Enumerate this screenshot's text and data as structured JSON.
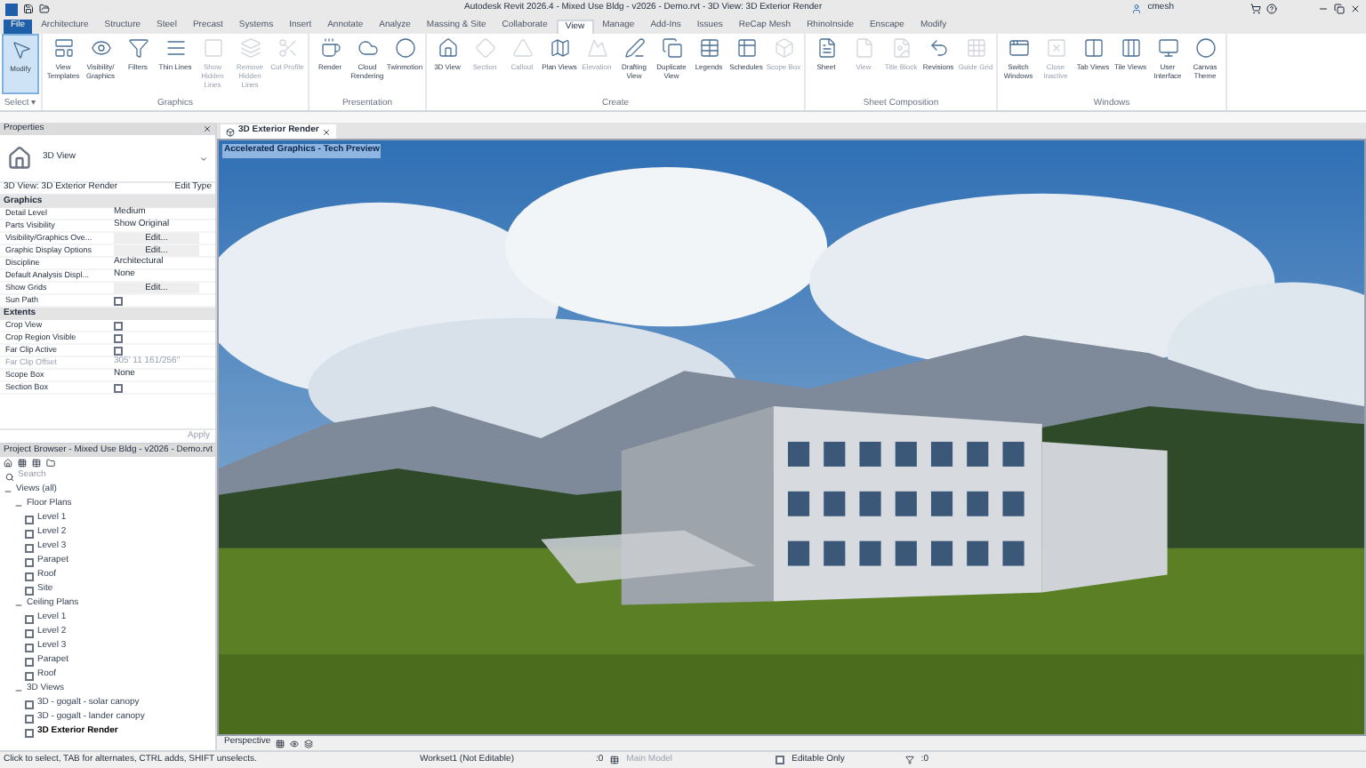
{
  "title_bar": {
    "title": "Autodesk Revit 2026.4 - Mixed Use Bldg - v2026 - Demo.rvt - 3D View: 3D Exterior Render",
    "user": "cmesh"
  },
  "ribbon_tabs": [
    {
      "label": "File",
      "selected": false,
      "kind": "file"
    },
    {
      "label": "Architecture",
      "selected": false,
      "kind": "tab"
    },
    {
      "label": "Structure",
      "selected": false,
      "kind": "tab"
    },
    {
      "label": "Steel",
      "selected": false,
      "kind": "tab"
    },
    {
      "label": "Precast",
      "selected": false,
      "kind": "tab"
    },
    {
      "label": "Systems",
      "selected": false,
      "kind": "tab"
    },
    {
      "label": "Insert",
      "selected": false,
      "kind": "tab"
    },
    {
      "label": "Annotate",
      "selected": false,
      "kind": "tab"
    },
    {
      "label": "Analyze",
      "selected": false,
      "kind": "tab"
    },
    {
      "label": "Massing & Site",
      "selected": false,
      "kind": "tab"
    },
    {
      "label": "Collaborate",
      "selected": false,
      "kind": "tab"
    },
    {
      "label": "View",
      "selected": true,
      "kind": "tab"
    },
    {
      "label": "Manage",
      "selected": false,
      "kind": "tab"
    },
    {
      "label": "Add-Ins",
      "selected": false,
      "kind": "tab"
    },
    {
      "label": "Issues",
      "selected": false,
      "kind": "tab"
    },
    {
      "label": "ReCap Mesh",
      "selected": false,
      "kind": "tab"
    },
    {
      "label": "RhinoInside",
      "selected": false,
      "kind": "tab"
    },
    {
      "label": "Enscape",
      "selected": false,
      "kind": "tab"
    },
    {
      "label": "Modify",
      "selected": false,
      "kind": "tab"
    }
  ],
  "ribbon_panels": [
    {
      "title": "Select ▾",
      "tools": [
        {
          "label": "Modify",
          "disabled": false,
          "selected": true
        }
      ]
    },
    {
      "title": "Graphics",
      "tools": [
        {
          "label": "View Templates",
          "disabled": false,
          "selected": false
        },
        {
          "label": "Visibility/ Graphics",
          "disabled": false,
          "selected": false
        },
        {
          "label": "Filters",
          "disabled": false,
          "selected": false
        },
        {
          "label": "Thin Lines",
          "disabled": false,
          "selected": false
        },
        {
          "label": "Show Hidden Lines",
          "disabled": true,
          "selected": false
        },
        {
          "label": "Remove Hidden Lines",
          "disabled": true,
          "selected": false
        },
        {
          "label": "Cut Profile",
          "disabled": true,
          "selected": false
        }
      ]
    },
    {
      "title": "Presentation",
      "tools": [
        {
          "label": "Render",
          "disabled": false,
          "selected": false
        },
        {
          "label": "Cloud Rendering",
          "disabled": false,
          "selected": false
        },
        {
          "label": "Twinmotion",
          "disabled": false,
          "selected": false
        }
      ]
    },
    {
      "title": "Create",
      "tools": [
        {
          "label": "3D View",
          "disabled": false,
          "selected": false
        },
        {
          "label": "Section",
          "disabled": true,
          "selected": false
        },
        {
          "label": "Callout",
          "disabled": true,
          "selected": false
        },
        {
          "label": "Plan Views",
          "disabled": false,
          "selected": false
        },
        {
          "label": "Elevation",
          "disabled": true,
          "selected": false
        },
        {
          "label": "Drafting View",
          "disabled": false,
          "selected": false
        },
        {
          "label": "Duplicate View",
          "disabled": false,
          "selected": false
        },
        {
          "label": "Legends",
          "disabled": false,
          "selected": false
        },
        {
          "label": "Schedules",
          "disabled": false,
          "selected": false
        },
        {
          "label": "Scope Box",
          "disabled": true,
          "selected": false
        }
      ]
    },
    {
      "title": "Sheet Composition",
      "tools": [
        {
          "label": "Sheet",
          "disabled": false,
          "selected": false
        },
        {
          "label": "View",
          "disabled": true,
          "selected": false
        },
        {
          "label": "Title Block",
          "disabled": true,
          "selected": false
        },
        {
          "label": "Revisions",
          "disabled": false,
          "selected": false
        },
        {
          "label": "Guide Grid",
          "disabled": true,
          "selected": false
        }
      ]
    },
    {
      "title": "Windows",
      "tools": [
        {
          "label": "Switch Windows",
          "disabled": false,
          "selected": false
        },
        {
          "label": "Close Inactive",
          "disabled": true,
          "selected": false
        },
        {
          "label": "Tab Views",
          "disabled": false,
          "selected": false
        },
        {
          "label": "Tile Views",
          "disabled": false,
          "selected": false
        },
        {
          "label": "User Interface",
          "disabled": false,
          "selected": false
        },
        {
          "label": "Canvas Theme",
          "disabled": false,
          "selected": false
        }
      ]
    }
  ],
  "properties": {
    "title": "Properties",
    "type_name": "3D View",
    "selector": "3D View: 3D Exterior Render",
    "edit_type": "Edit Type",
    "apply": "Apply",
    "groups": [
      {
        "title": "Graphics",
        "rows": [
          {
            "name": "Detail Level",
            "kind": "text",
            "value": "Medium"
          },
          {
            "name": "Parts Visibility",
            "kind": "text",
            "value": "Show Original"
          },
          {
            "name": "Visibility/Graphics Ove...",
            "kind": "button",
            "value": "Edit..."
          },
          {
            "name": "Graphic Display Options",
            "kind": "button",
            "value": "Edit..."
          },
          {
            "name": "Discipline",
            "kind": "text",
            "value": "Architectural"
          },
          {
            "name": "Default Analysis Displ...",
            "kind": "text",
            "value": "None"
          },
          {
            "name": "Show Grids",
            "kind": "button",
            "value": "Edit..."
          },
          {
            "name": "Sun Path",
            "kind": "checkbox",
            "checked": false
          }
        ]
      },
      {
        "title": "Extents",
        "rows": [
          {
            "name": "Crop View",
            "kind": "checkbox",
            "checked": false
          },
          {
            "name": "Crop Region Visible",
            "kind": "checkbox",
            "checked": false
          },
          {
            "name": "Far Clip Active",
            "kind": "checkbox",
            "checked": false
          },
          {
            "name": "Far Clip Offset",
            "kind": "text",
            "value": "305' 11 161/256\"",
            "disabled": true
          },
          {
            "name": "Scope Box",
            "kind": "text",
            "value": "None"
          },
          {
            "name": "Section Box",
            "kind": "checkbox",
            "checked": false
          }
        ]
      }
    ]
  },
  "project_browser": {
    "title": "Project Browser - Mixed Use Bldg - v2026 - Demo.rvt",
    "search": {
      "placeholder": "Search"
    },
    "tree": [
      {
        "label": "Views (all)",
        "expanded": true,
        "children": [
          {
            "label": "Floor Plans",
            "expanded": true,
            "children": [
              {
                "label": "Level 1",
                "selected": false
              },
              {
                "label": "Level 2",
                "selected": false
              },
              {
                "label": "Level 3",
                "selected": false
              },
              {
                "label": "Parapet",
                "selected": false
              },
              {
                "label": "Roof",
                "selected": false
              },
              {
                "label": "Site",
                "selected": false
              }
            ]
          },
          {
            "label": "Ceiling Plans",
            "expanded": true,
            "children": [
              {
                "label": "Level 1",
                "selected": false
              },
              {
                "label": "Level 2",
                "selected": false
              },
              {
                "label": "Level 3",
                "selected": false
              },
              {
                "label": "Parapet",
                "selected": false
              },
              {
                "label": "Roof",
                "selected": false
              }
            ]
          },
          {
            "label": "3D Views",
            "expanded": true,
            "children": [
              {
                "label": "3D - gogalt - solar canopy",
                "selected": false
              },
              {
                "label": "3D - gogalt - lander canopy",
                "selected": false
              },
              {
                "label": "3D Exterior Render",
                "selected": true
              }
            ]
          }
        ]
      }
    ]
  },
  "view_tab": {
    "label": "3D Exterior Render",
    "overlay": "Accelerated Graphics - Tech Preview"
  },
  "view_control_bar": {
    "mode": "Perspective"
  },
  "status_bar": {
    "message": "Click to select, TAB for alternates, CTRL adds, SHIFT unselects.",
    "workset": "Workset1 (Not Editable)",
    "count": ":0",
    "model": "Main Model",
    "editable_only": {
      "label": "Editable Only",
      "checked": false
    },
    "filter_count": ":0"
  }
}
